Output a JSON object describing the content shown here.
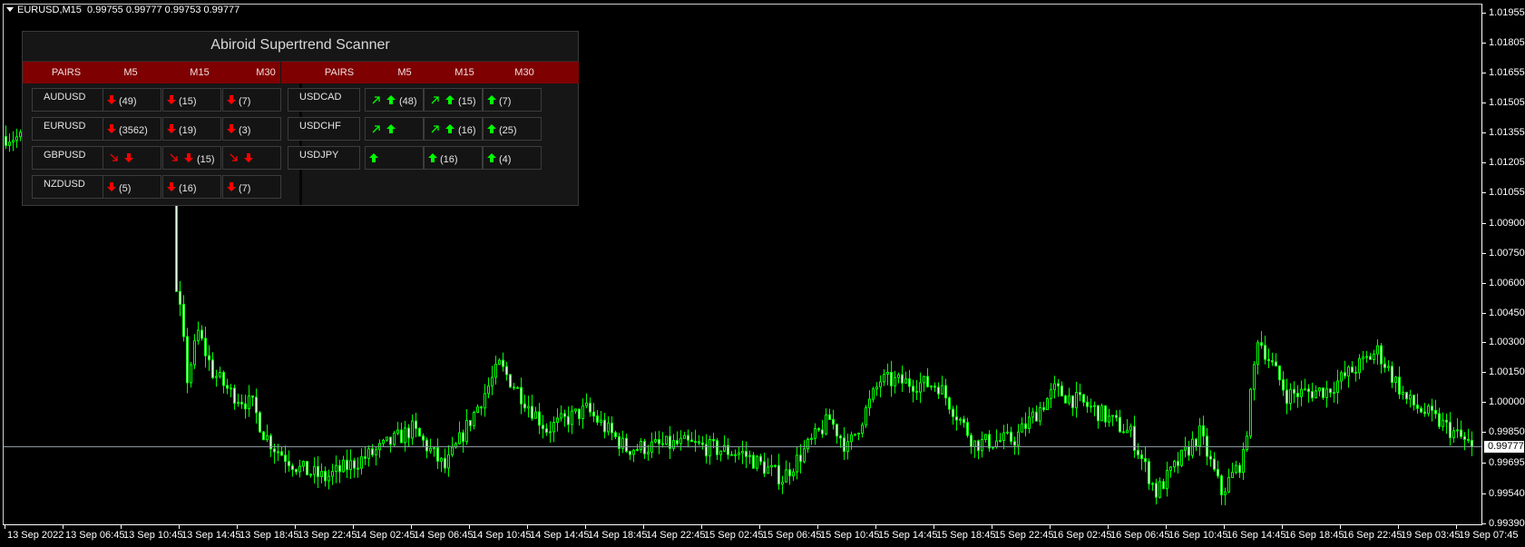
{
  "chart": {
    "symbol_label": "EURUSD,M15",
    "ohlc": "0.99755 0.99777 0.99753 0.99777",
    "current_price": "0.99777",
    "colors": {
      "background": "#000000",
      "candle_outline": "#00ff00",
      "bear_fill": "#ffffff",
      "bull_fill": "#000000",
      "price_line": "#8a96a0"
    }
  },
  "chart_data": {
    "type": "candlestick",
    "symbol": "EURUSD",
    "timeframe": "M15",
    "price_axis_labels": [
      "1.01955",
      "1.01805",
      "1.01655",
      "1.01505",
      "1.01355",
      "1.01205",
      "1.01055",
      "1.00900",
      "1.00750",
      "1.00600",
      "1.00450",
      "1.00300",
      "1.00150",
      "1.00000",
      "0.99850",
      "0.99695",
      "0.99540",
      "0.99390"
    ],
    "time_axis_labels": [
      "13 Sep 2022",
      "13 Sep 06:45",
      "13 Sep 10:45",
      "13 Sep 14:45",
      "13 Sep 18:45",
      "13 Sep 22:45",
      "14 Sep 02:45",
      "14 Sep 06:45",
      "14 Sep 10:45",
      "14 Sep 14:45",
      "14 Sep 18:45",
      "14 Sep 22:45",
      "15 Sep 02:45",
      "15 Sep 06:45",
      "15 Sep 10:45",
      "15 Sep 14:45",
      "15 Sep 18:45",
      "15 Sep 22:45",
      "16 Sep 02:45",
      "16 Sep 06:45",
      "16 Sep 10:45",
      "16 Sep 14:45",
      "16 Sep 18:45",
      "16 Sep 22:45",
      "19 Sep 03:45",
      "19 Sep 07:45"
    ],
    "ylim": [
      0.9939,
      1.01955
    ],
    "approx_close_path": [
      [
        "13 Sep 02:45",
        1.01335
      ],
      [
        "13 Sep 10:15",
        1.0128
      ],
      [
        "13 Sep 14:15",
        1.0125
      ],
      [
        "13 Sep 14:30",
        1.00539
      ],
      [
        "13 Sep 14:45",
        1.00457
      ],
      [
        "13 Sep 15:15",
        1.0012
      ],
      [
        "13 Sep 16:00",
        1.0035
      ],
      [
        "13 Sep 17:00",
        1.0015
      ],
      [
        "13 Sep 18:15",
        1.00047
      ],
      [
        "13 Sep 19:45",
        0.99983
      ],
      [
        "13 Sep 20:30",
        0.99846
      ],
      [
        "13 Sep 21:15",
        0.99773
      ],
      [
        "13 Sep 23:00",
        0.99664
      ],
      [
        "14 Sep 00:45",
        0.99618
      ],
      [
        "14 Sep 04:00",
        0.99741
      ],
      [
        "14 Sep 06:45",
        0.99864
      ],
      [
        "14 Sep 09:00",
        0.99668
      ],
      [
        "14 Sep 12:45",
        1.00183
      ],
      [
        "14 Sep 16:00",
        0.99864
      ],
      [
        "14 Sep 18:45",
        0.99962
      ],
      [
        "14 Sep 21:30",
        0.99766
      ],
      [
        "15 Sep 01:30",
        0.99791
      ],
      [
        "15 Sep 05:30",
        0.99741
      ],
      [
        "15 Sep 08:15",
        0.99618
      ],
      [
        "15 Sep 11:30",
        0.99914
      ],
      [
        "15 Sep 12:45",
        0.99766
      ],
      [
        "15 Sep 15:00",
        1.0011
      ],
      [
        "15 Sep 19:00",
        1.00085
      ],
      [
        "15 Sep 21:30",
        0.99791
      ],
      [
        "16 Sep 00:15",
        0.99814
      ],
      [
        "16 Sep 03:00",
        1.0006
      ],
      [
        "16 Sep 05:45",
        0.99962
      ],
      [
        "16 Sep 08:15",
        0.99841
      ],
      [
        "16 Sep 10:00",
        0.99545
      ],
      [
        "16 Sep 13:00",
        0.99841
      ],
      [
        "16 Sep 14:30",
        0.99545
      ],
      [
        "16 Sep 16:00",
        0.99718
      ],
      [
        "16 Sep 17:00",
        1.00329
      ],
      [
        "16 Sep 19:00",
        1.00037
      ],
      [
        "16 Sep 21:45",
        1.0006
      ],
      [
        "19 Sep 02:15",
        1.00256
      ],
      [
        "19 Sep 04:15",
        1.0001
      ],
      [
        "19 Sep 06:45",
        0.99887
      ],
      [
        "19 Sep 08:45",
        0.99777
      ]
    ]
  },
  "scanner": {
    "title": "Abiroid Supertrend Scanner",
    "header_color": "#7f0000",
    "up_color": "#00ff00",
    "down_color": "#ff0000",
    "groups": [
      {
        "headers": [
          "PAIRS",
          "M5",
          "M15",
          "M30"
        ],
        "rows": [
          {
            "pair": "AUDUSD",
            "cells": [
              {
                "icons": [
                  "arrow-down"
                ],
                "count": "(49)"
              },
              {
                "icons": [
                  "arrow-down"
                ],
                "count": "(15)"
              },
              {
                "icons": [
                  "arrow-down"
                ],
                "count": "(7)"
              }
            ]
          },
          {
            "pair": "EURUSD",
            "cells": [
              {
                "icons": [
                  "arrow-down"
                ],
                "count": "(3562)"
              },
              {
                "icons": [
                  "arrow-down"
                ],
                "count": "(19)"
              },
              {
                "icons": [
                  "arrow-down"
                ],
                "count": "(3)"
              }
            ]
          },
          {
            "pair": "GBPUSD",
            "cells": [
              {
                "icons": [
                  "arrow-down-right",
                  "arrow-down"
                ],
                "count": ""
              },
              {
                "icons": [
                  "arrow-down-right",
                  "arrow-down"
                ],
                "count": "(15)"
              },
              {
                "icons": [
                  "arrow-down-right",
                  "arrow-down"
                ],
                "count": ""
              }
            ]
          },
          {
            "pair": "NZDUSD",
            "cells": [
              {
                "icons": [
                  "arrow-down"
                ],
                "count": "(5)"
              },
              {
                "icons": [
                  "arrow-down"
                ],
                "count": "(16)"
              },
              {
                "icons": [
                  "arrow-down"
                ],
                "count": "(7)"
              }
            ]
          }
        ]
      },
      {
        "headers": [
          "PAIRS",
          "M5",
          "M15",
          "M30"
        ],
        "rows": [
          {
            "pair": "USDCAD",
            "cells": [
              {
                "icons": [
                  "arrow-up-right",
                  "arrow-up"
                ],
                "count": "(48)"
              },
              {
                "icons": [
                  "arrow-up-right",
                  "arrow-up"
                ],
                "count": "(15)"
              },
              {
                "icons": [
                  "arrow-up"
                ],
                "count": "(7)"
              }
            ]
          },
          {
            "pair": "USDCHF",
            "cells": [
              {
                "icons": [
                  "arrow-up-right",
                  "arrow-up"
                ],
                "count": ""
              },
              {
                "icons": [
                  "arrow-up-right",
                  "arrow-up"
                ],
                "count": "(16)"
              },
              {
                "icons": [
                  "arrow-up"
                ],
                "count": "(25)"
              }
            ]
          },
          {
            "pair": "USDJPY",
            "cells": [
              {
                "icons": [
                  "arrow-up"
                ],
                "count": ""
              },
              {
                "icons": [
                  "arrow-up"
                ],
                "count": "(16)"
              },
              {
                "icons": [
                  "arrow-up"
                ],
                "count": "(4)"
              }
            ]
          }
        ]
      }
    ]
  }
}
